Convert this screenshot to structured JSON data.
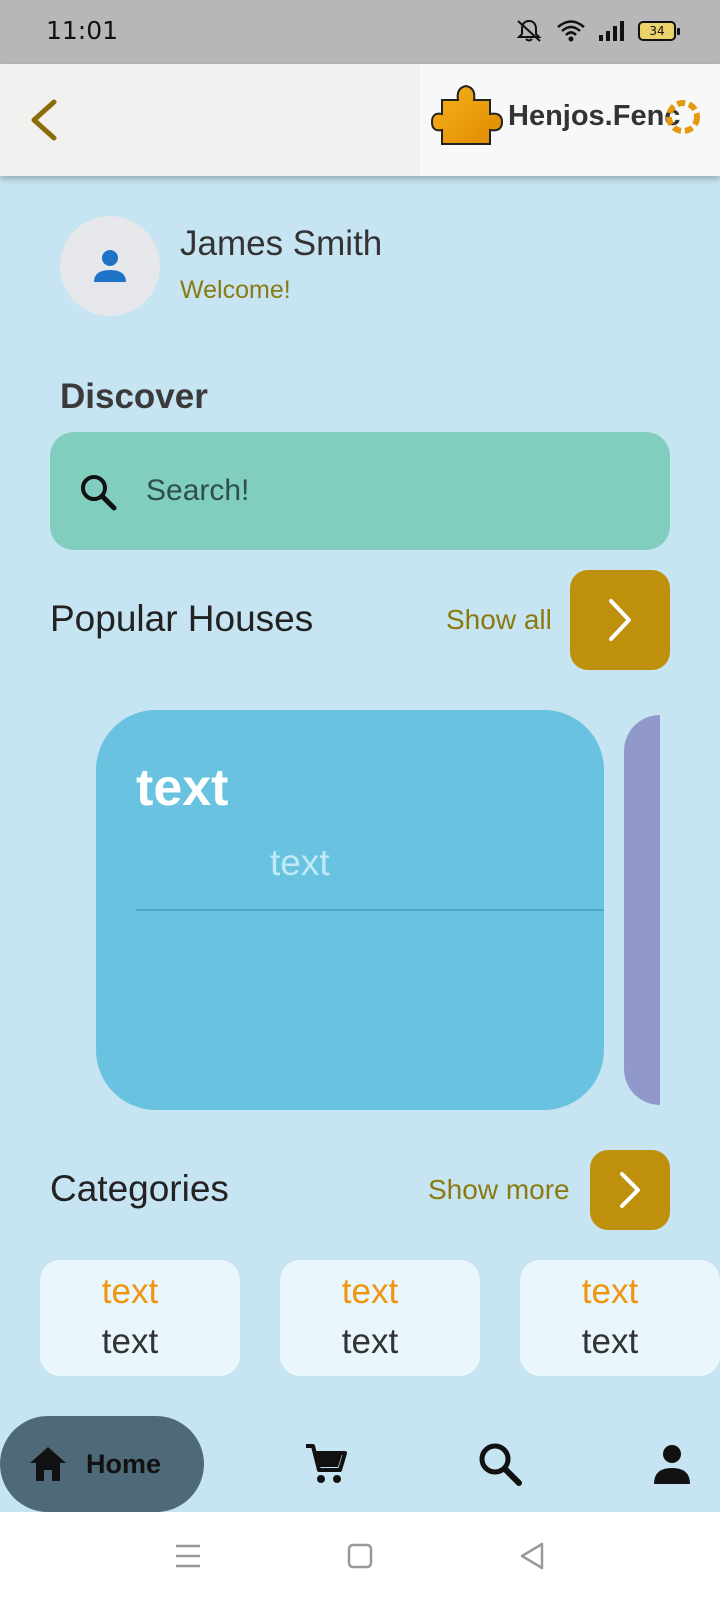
{
  "status_bar": {
    "time": "11:01",
    "battery": "34"
  },
  "header": {
    "logo_text": "Henjos.Fenc"
  },
  "profile": {
    "name": "James Smith",
    "greeting": "Welcome!"
  },
  "discover": {
    "title": "Discover",
    "search_placeholder": "Search!"
  },
  "popular": {
    "title": "Popular Houses",
    "show_all": "Show all",
    "cards": [
      {
        "title": "text",
        "subtitle": "text",
        "color": "#69c3e0"
      },
      {
        "color": "#9199cb"
      }
    ]
  },
  "categories": {
    "title": "Categories",
    "show_more": "Show more",
    "items": [
      {
        "top": "text",
        "bottom": "text"
      },
      {
        "top": "text",
        "bottom": "text"
      },
      {
        "top": "text",
        "bottom": "text"
      }
    ]
  },
  "bottom_nav": {
    "home_label": "Home",
    "items": [
      "home-icon",
      "cart-icon",
      "search-icon",
      "person-icon"
    ]
  },
  "colors": {
    "background": "#c6e4f1",
    "accent": "#bf900c",
    "search_bg": "#82cebe",
    "highlight_text": "#f0940e"
  }
}
